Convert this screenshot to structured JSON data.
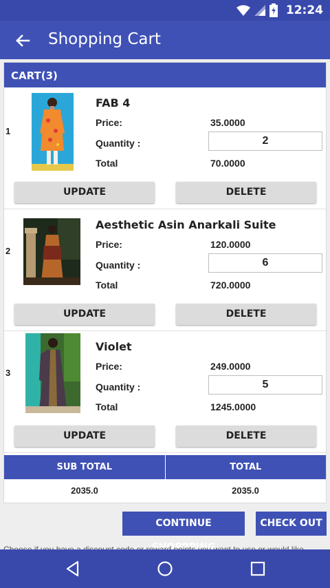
{
  "status_bar": {
    "time": "12:24"
  },
  "app_bar": {
    "title": "Shopping Cart"
  },
  "cart": {
    "header": "CART(3)",
    "price_label": "Price:",
    "quantity_label": "Quantity :",
    "total_label": "Total",
    "update_label": "UPDATE",
    "delete_label": "DELETE",
    "items": [
      {
        "index": "1",
        "name": "FAB 4",
        "price": "35.0000",
        "quantity": "2",
        "total": "70.0000"
      },
      {
        "index": "2",
        "name": "Aesthetic Asin Anarkali Suite",
        "price": "120.0000",
        "quantity": "6",
        "total": "720.0000"
      },
      {
        "index": "3",
        "name": "Violet",
        "price": "249.0000",
        "quantity": "5",
        "total": "1245.0000"
      }
    ],
    "subtotal_label": "SUB TOTAL",
    "total_header_label": "TOTAL",
    "subtotal_value": "2035.0",
    "total_value": "2035.0"
  },
  "actions": {
    "continue_label": "CONTINUE SHOPPPING",
    "checkout_label": "CHECK OUT"
  },
  "discount_note": "Choose if you have a discount code or reward points you want to use or would like",
  "colors": {
    "primary": "#3f51b5",
    "status_bar": "#3949ab",
    "button_gray": "#dcdcdc"
  }
}
